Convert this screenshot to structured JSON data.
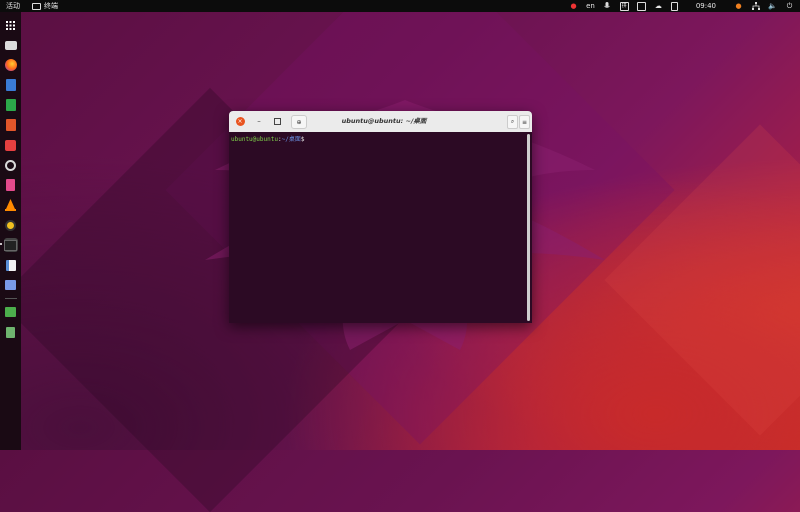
{
  "topbar": {
    "activities": "活动",
    "app_name": "终端",
    "language": "en",
    "clock": "09:40"
  },
  "dock": {
    "items": [
      {
        "name": "show-apps",
        "icon": "grid-icon",
        "color": "#ffffff"
      },
      {
        "name": "files",
        "icon": "folder-icon",
        "color": "#dcdcdc"
      },
      {
        "name": "firefox",
        "icon": "firefox-icon",
        "color": "#ff6a1a"
      },
      {
        "name": "thunderbird",
        "icon": "mail-icon",
        "color": "#3a7bd5"
      },
      {
        "name": "calc",
        "icon": "spreadsheet-icon",
        "color": "#2ca84a"
      },
      {
        "name": "impress",
        "icon": "presentation-icon",
        "color": "#e2562a"
      },
      {
        "name": "software",
        "icon": "store-icon",
        "color": "#e64040"
      },
      {
        "name": "rhythmbox",
        "icon": "music-icon",
        "color": "#d9d9d9"
      },
      {
        "name": "music",
        "icon": "note-icon",
        "color": "#e34b8c"
      },
      {
        "name": "vlc",
        "icon": "cone-icon",
        "color": "#ff8a00"
      },
      {
        "name": "speaker",
        "icon": "speaker-icon",
        "color": "#f0c020"
      },
      {
        "name": "terminal",
        "icon": "terminal-icon",
        "color": "#333333"
      },
      {
        "name": "text-editor",
        "icon": "pencil-icon",
        "color": "#5a8fd6"
      },
      {
        "name": "settings",
        "icon": "window-icon",
        "color": "#7a9be8"
      },
      {
        "name": "usb",
        "icon": "usb-icon",
        "color": "#4cae4c"
      },
      {
        "name": "trash",
        "icon": "trash-icon",
        "color": "#6fb46f"
      }
    ]
  },
  "terminal": {
    "title": "ubuntu@ubuntu: ~/桌面",
    "prompt_user": "ubuntu@ubuntu",
    "prompt_sep": ":",
    "prompt_path": "~/桌面",
    "prompt_symbol": "$"
  }
}
